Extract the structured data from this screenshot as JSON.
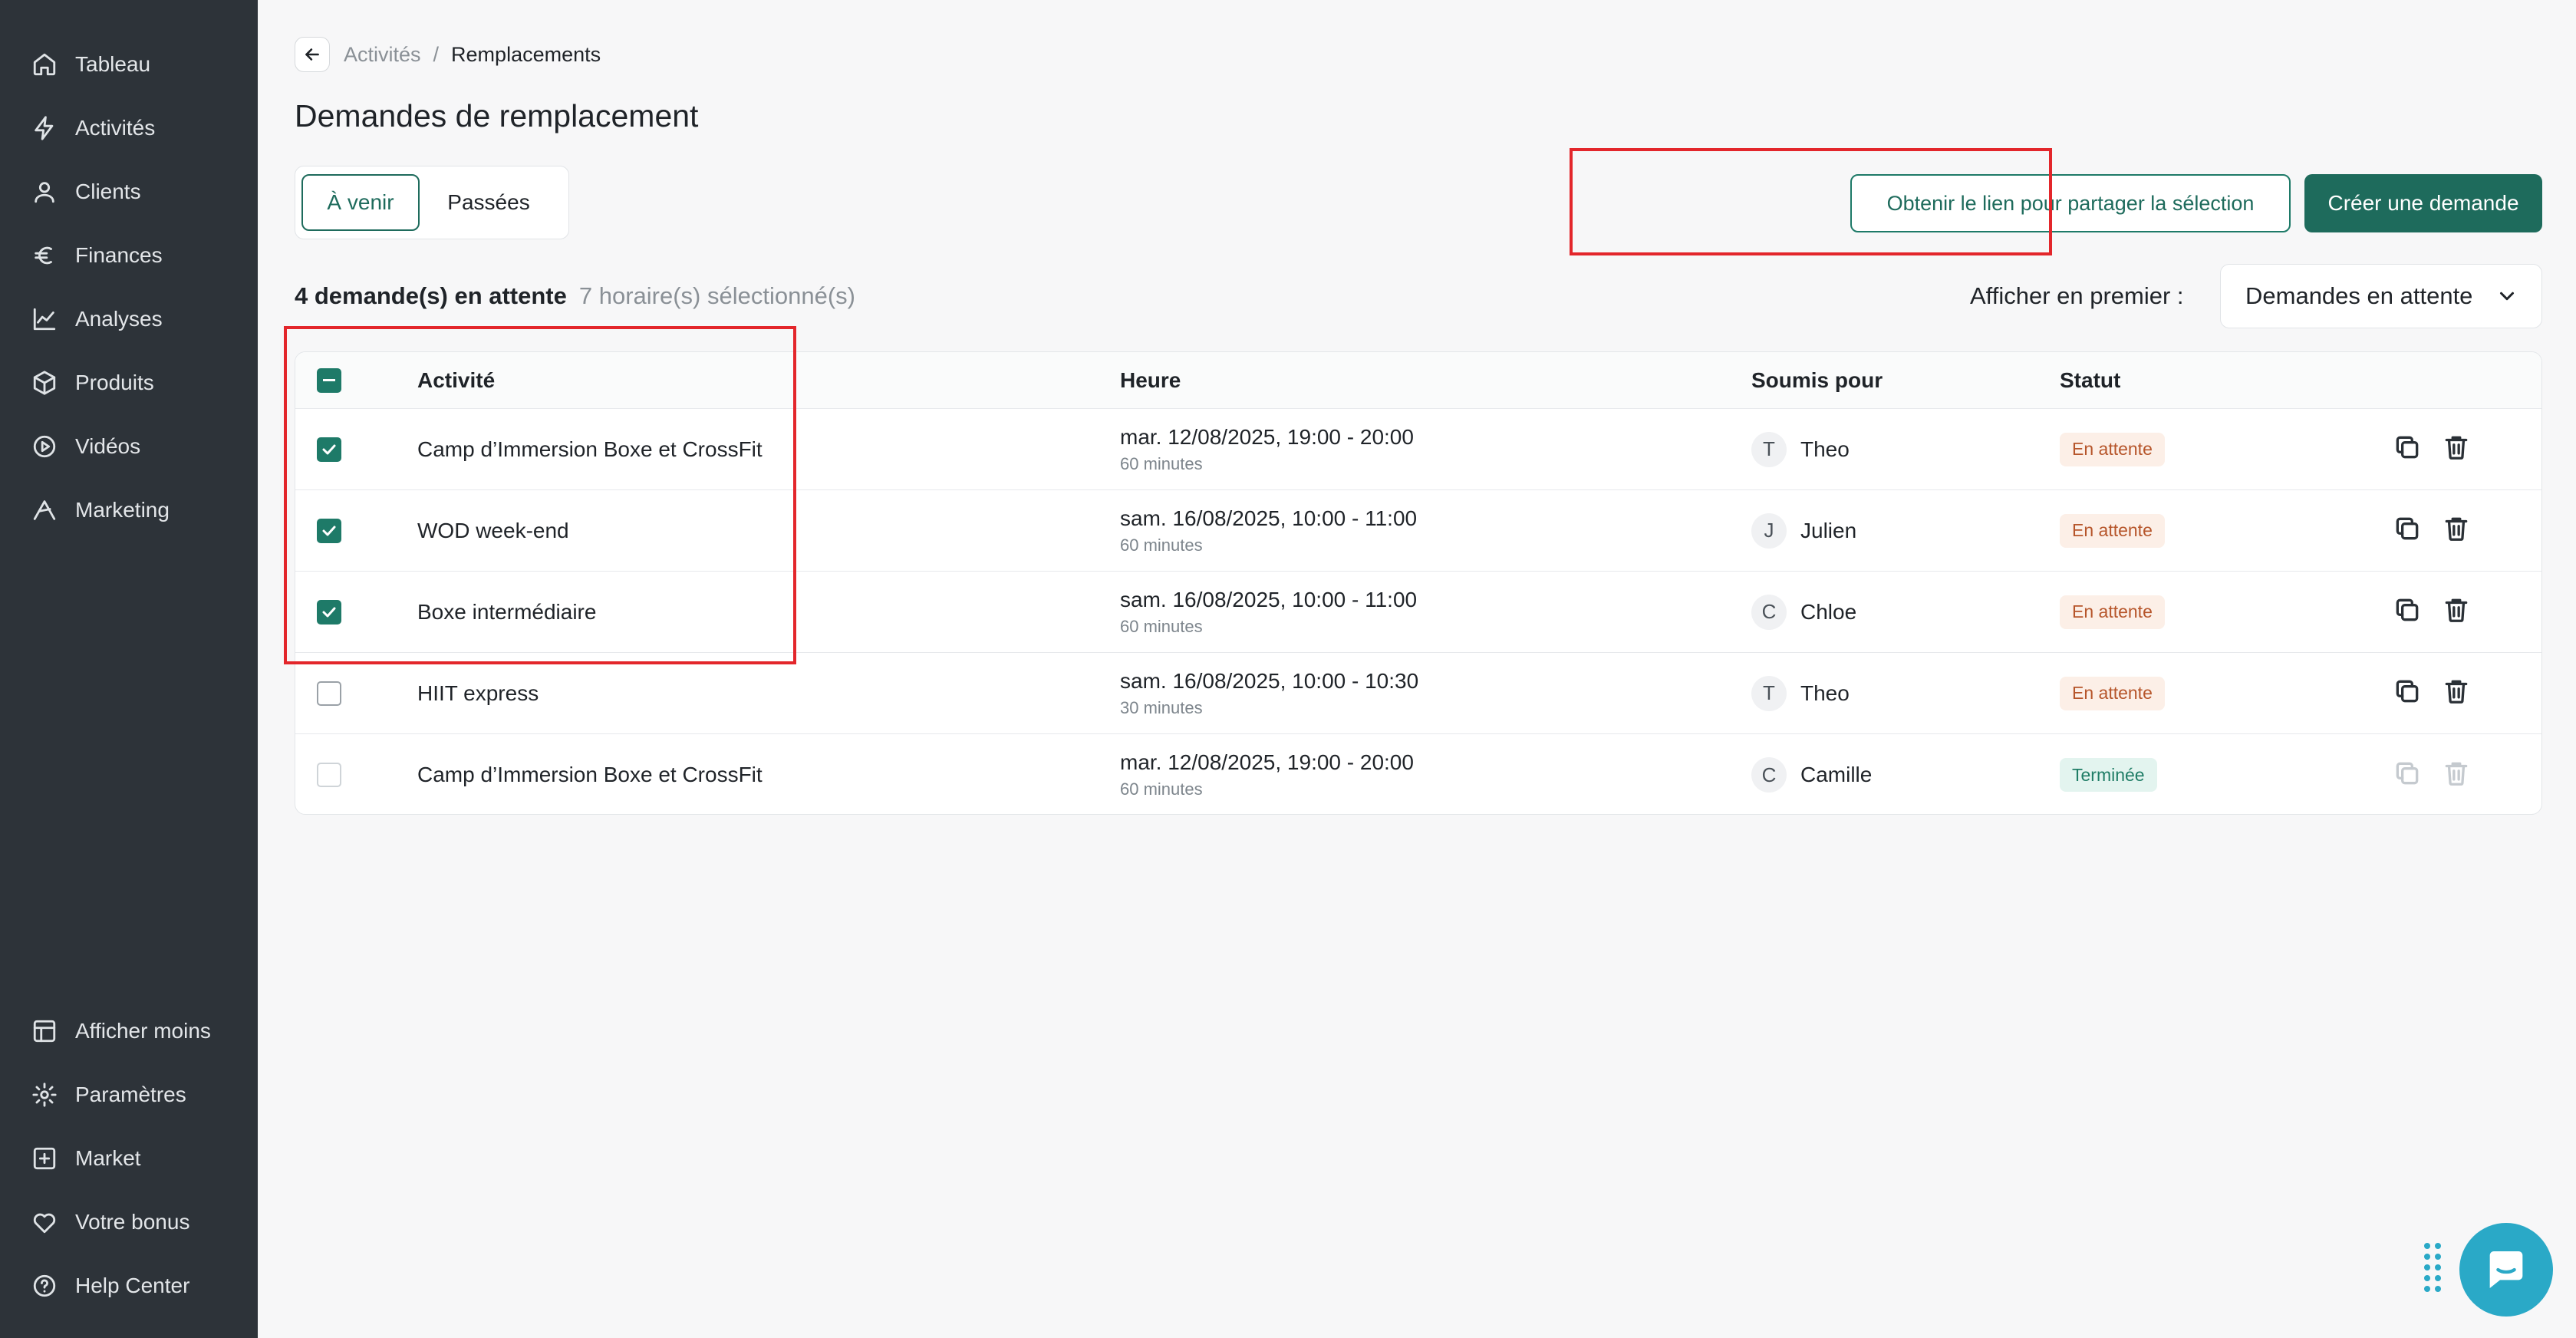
{
  "sidebar": {
    "top_items": [
      {
        "label": "Tableau",
        "icon": "home-icon"
      },
      {
        "label": "Activités",
        "icon": "lightning-icon"
      },
      {
        "label": "Clients",
        "icon": "user-icon"
      },
      {
        "label": "Finances",
        "icon": "euro-icon"
      },
      {
        "label": "Analyses",
        "icon": "chart-line-icon"
      },
      {
        "label": "Produits",
        "icon": "box-icon"
      },
      {
        "label": "Vidéos",
        "icon": "play-circle-icon"
      },
      {
        "label": "Marketing",
        "icon": "megaphone-icon"
      }
    ],
    "bottom_items": [
      {
        "label": "Afficher moins",
        "icon": "panel-icon"
      },
      {
        "label": "Paramètres",
        "icon": "gear-icon"
      },
      {
        "label": "Market",
        "icon": "plus-square-icon"
      },
      {
        "label": "Votre bonus",
        "icon": "heart-icon"
      },
      {
        "label": "Help Center",
        "icon": "help-circle-icon"
      }
    ]
  },
  "breadcrumb": {
    "parent": "Activités",
    "separator": "/",
    "current": "Remplacements"
  },
  "page_title": "Demandes de remplacement",
  "tabs": [
    {
      "label": "À venir",
      "active": true
    },
    {
      "label": "Passées",
      "active": false
    }
  ],
  "actions": {
    "share_label": "Obtenir le lien pour partager la sélection",
    "create_label": "Créer une demande"
  },
  "summary": {
    "pending": "4 demande(s) en attente",
    "selected": "7 horaire(s) sélectionné(s)"
  },
  "sort": {
    "label": "Afficher en premier :",
    "value": "Demandes en attente"
  },
  "table": {
    "headers": {
      "activity": "Activité",
      "time": "Heure",
      "submitted_for": "Soumis pour",
      "status": "Statut"
    },
    "rows": [
      {
        "checked": true,
        "activity": "Camp d’Immersion Boxe et CrossFit",
        "time": "mar. 12/08/2025, 19:00 - 20:00",
        "duration": "60 minutes",
        "initial": "T",
        "person": "Theo",
        "status": "En attente",
        "status_kind": "pending"
      },
      {
        "checked": true,
        "activity": "WOD week-end",
        "time": "sam. 16/08/2025, 10:00 - 11:00",
        "duration": "60 minutes",
        "initial": "J",
        "person": "Julien",
        "status": "En attente",
        "status_kind": "pending"
      },
      {
        "checked": true,
        "activity": "Boxe intermédiaire",
        "time": "sam. 16/08/2025, 10:00 - 11:00",
        "duration": "60 minutes",
        "initial": "C",
        "person": "Chloe",
        "status": "En attente",
        "status_kind": "pending"
      },
      {
        "checked": false,
        "activity": "HIIT express",
        "time": "sam. 16/08/2025, 10:00 - 10:30",
        "duration": "30 minutes",
        "initial": "T",
        "person": "Theo",
        "status": "En attente",
        "status_kind": "pending"
      },
      {
        "checked": false,
        "activity": "Camp d’Immersion Boxe et CrossFit",
        "time": "mar. 12/08/2025, 19:00 - 20:00",
        "duration": "60 minutes",
        "initial": "C",
        "person": "Camille",
        "status": "Terminée",
        "status_kind": "done"
      }
    ]
  },
  "colors": {
    "accent": "#1e6b5c",
    "sidebar": "#2d3339",
    "highlight": "#e3262b",
    "chat": "#2aa9c7"
  }
}
